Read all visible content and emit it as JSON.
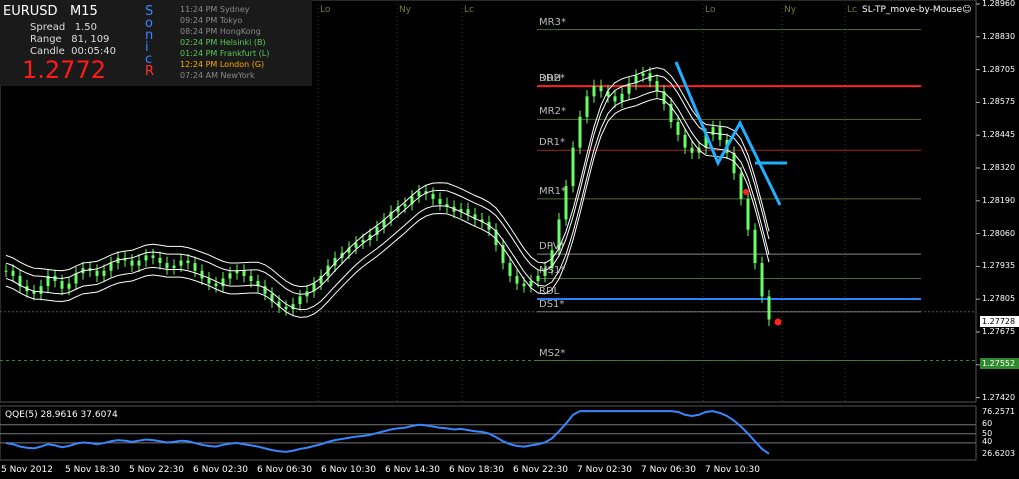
{
  "symbol": {
    "pair": "EURUSD",
    "timeframe": "M15"
  },
  "info": {
    "spread_label": "Spread",
    "spread": "1.50",
    "range_label": "Range",
    "range": "81, 109",
    "candle_label": "Candle",
    "candle": "00:05:40",
    "price": "1.2772"
  },
  "sonic_letters": [
    "S",
    "o",
    "n",
    "i",
    "c",
    "R"
  ],
  "sessions": [
    {
      "time": "11:24 PM",
      "city": "Sydney",
      "color": "#8a8a8a"
    },
    {
      "time": "09:24 PM",
      "city": "Tokyo",
      "color": "#8a8a8a"
    },
    {
      "time": "08:24 PM",
      "city": "HongKong",
      "color": "#8a8a8a"
    },
    {
      "time": "02:24 PM",
      "city": "Helsinki  (B)",
      "color": "#55cc55"
    },
    {
      "time": "01:24 PM",
      "city": "Frankfurt  (L)",
      "color": "#55cc55"
    },
    {
      "time": "12:24 PM",
      "city": "London  (G)",
      "color": "#ffaa00"
    },
    {
      "time": "07:24 AM",
      "city": "NewYork",
      "color": "#8a8a8a"
    }
  ],
  "session_tags": [
    "Lo",
    "Ny",
    "Lc",
    "Lo",
    "Ny",
    "Lc"
  ],
  "tool_label": "SL-TP_move-by-Mouse☺",
  "price_axis": [
    "1.28960",
    "1.28830",
    "1.28705",
    "1.28575",
    "1.28445",
    "1.28320",
    "1.28190",
    "1.28060",
    "1.27935",
    "1.27805",
    "1.27675",
    "1.27545",
    "1.27420"
  ],
  "price_box_current": "1.27728",
  "price_box_green": "1.27552",
  "pivots": [
    {
      "label": "MR3*",
      "value": 1.2886,
      "color": "#556b2f"
    },
    {
      "label": "DR2*",
      "value": 1.2864,
      "color": "#ff2020"
    },
    {
      "label": "RDH",
      "value": 1.2864,
      "color": "#ff2020"
    },
    {
      "label": "MR2*",
      "value": 1.2851,
      "color": "#556b2f"
    },
    {
      "label": "DR1*",
      "value": 1.2839,
      "color": "#aa2222"
    },
    {
      "label": "MR1*",
      "value": 1.282,
      "color": "#556b2f"
    },
    {
      "label": "DPV*",
      "value": 1.27985,
      "color": "#888888"
    },
    {
      "label": "MS1*",
      "value": 1.2789,
      "color": "#556b2f"
    },
    {
      "label": "RDL",
      "value": 1.2781,
      "color": "#2a7fff"
    },
    {
      "label": "DS1*",
      "value": 1.2776,
      "color": "#888888"
    },
    {
      "label": "MS2*",
      "value": 1.2757,
      "color": "#556b2f"
    }
  ],
  "qqe": {
    "label": "QQE(5) 28.9616 37.6074",
    "axis": [
      "76.2571",
      "60",
      "50",
      "40",
      "26.6203"
    ]
  },
  "time_axis": [
    "5 Nov 2012",
    "5 Nov 18:30",
    "5 Nov 22:30",
    "6 Nov 02:30",
    "6 Nov 06:30",
    "6 Nov 10:30",
    "6 Nov 14:30",
    "6 Nov 18:30",
    "6 Nov 22:30",
    "7 Nov 02:30",
    "7 Nov 06:30",
    "7 Nov 10:30"
  ],
  "colors": {
    "candle": "#66ff66",
    "zigzag": "#20b0ff",
    "bands": "#ffffff",
    "qqe": "#3a86ff",
    "grid": "#2a2a2a"
  },
  "chart_data": {
    "type": "line",
    "title": "EURUSD M15",
    "ylim": [
      1.2742,
      1.2896
    ],
    "close": [
      1.2792,
      1.279,
      1.2786,
      1.2784,
      1.2783,
      1.2786,
      1.279,
      1.2788,
      1.2785,
      1.2787,
      1.2791,
      1.2793,
      1.2792,
      1.279,
      1.2792,
      1.2795,
      1.2797,
      1.2796,
      1.2794,
      1.2796,
      1.2798,
      1.2797,
      1.2795,
      1.2793,
      1.2794,
      1.2796,
      1.2795,
      1.2792,
      1.2789,
      1.2787,
      1.2786,
      1.2789,
      1.2791,
      1.2792,
      1.279,
      1.2788,
      1.2786,
      1.2783,
      1.278,
      1.2778,
      1.2777,
      1.2779,
      1.2782,
      1.2784,
      1.2787,
      1.279,
      1.2794,
      1.2797,
      1.2799,
      1.2801,
      1.2803,
      1.2804,
      1.2806,
      1.2809,
      1.2812,
      1.2815,
      1.2817,
      1.2818,
      1.2821,
      1.2823,
      1.2822,
      1.282,
      1.2818,
      1.2817,
      1.2815,
      1.2816,
      1.2814,
      1.2812,
      1.2811,
      1.2808,
      1.2802,
      1.2795,
      1.279,
      1.2787,
      1.2786,
      1.2788,
      1.279,
      1.2793,
      1.28,
      1.2812,
      1.2825,
      1.284,
      1.2852,
      1.286,
      1.2864,
      1.2862,
      1.286,
      1.2858,
      1.2861,
      1.2865,
      1.2868,
      1.2869,
      1.2866,
      1.2862,
      1.2857,
      1.285,
      1.2845,
      1.284,
      1.2838,
      1.284,
      1.2845,
      1.2848,
      1.2843,
      1.2838,
      1.283,
      1.282,
      1.2808,
      1.2795,
      1.2782,
      1.2773
    ]
  }
}
